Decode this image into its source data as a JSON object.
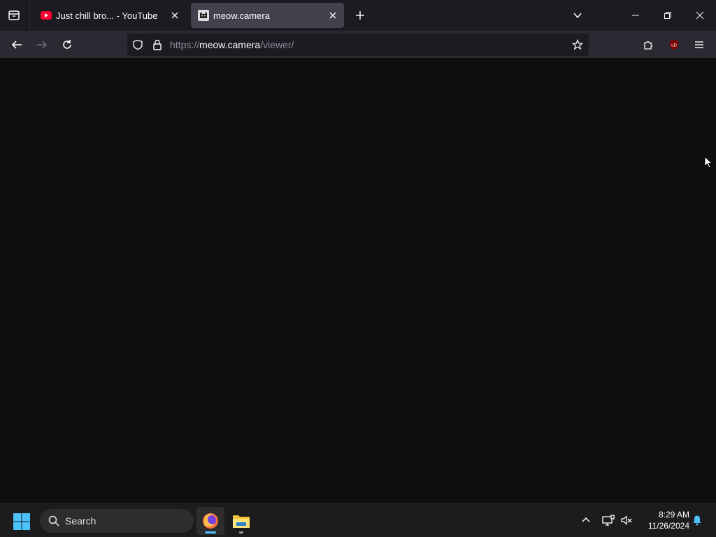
{
  "browser": {
    "tabs": [
      {
        "title": "Just chill bro... - YouTube",
        "favicon": "youtube-icon",
        "active": false
      },
      {
        "title": "meow.camera",
        "favicon": "cat-icon",
        "active": true
      }
    ],
    "url": {
      "scheme": "https://",
      "host": "meow.camera",
      "path": "/viewer/"
    }
  },
  "taskbar": {
    "search_label": "Search",
    "time": "8:29 AM",
    "date": "11/26/2024"
  },
  "colors": {
    "content_bg": "#0e0e0f",
    "tabbar_bg": "#1c1b22",
    "navbar_bg": "#2b2a33",
    "active_tab": "#42414d",
    "taskbar_bg": "#1c1c1c",
    "accent": "#4cc2ff"
  }
}
